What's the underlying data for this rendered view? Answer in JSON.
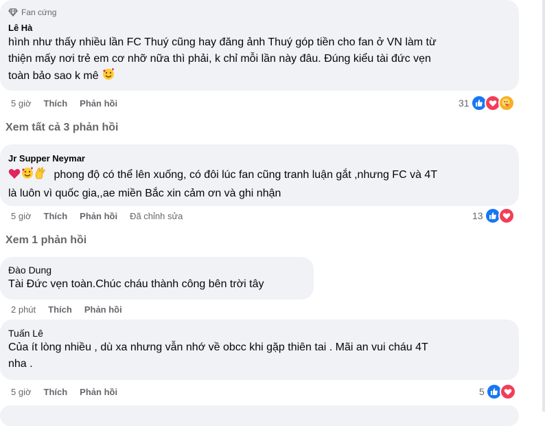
{
  "comments": [
    {
      "badge": "Fan cứng",
      "author": "Lê Hà",
      "lines": [
        "hình như thấy nhiều lần FC Thuý cũng hay đăng ảnh Thuý góp tiền cho fan ở VN làm từ",
        "thiện mấy nơi trẻ em cơ nhỡ nữa thì phải, k chỉ mỗi lần này đâu. Đúng kiểu tài đức vẹn",
        "toàn bảo sao k mê"
      ],
      "time": "5 giờ",
      "like": "Thích",
      "reply": "Phản hồi",
      "reactions": "31"
    },
    {
      "author": "Jr Supper Neymar",
      "lines": [
        "phong độ có thể lên xuống, có đôi lúc fan cũng tranh luận gắt ,nhưng FC và 4T",
        "là luôn vì quốc gia,,ae miền Bắc xin cảm ơn và ghi nhận"
      ],
      "time": "5 giờ",
      "like": "Thích",
      "reply": "Phản hồi",
      "edited": "Đã chỉnh sửa",
      "reactions": "13"
    },
    {
      "author": "Đào Dung",
      "lines": [
        "Tài Đức vẹn toàn.Chúc cháu thành công bên trời tây"
      ],
      "time": "2 phút",
      "like": "Thích",
      "reply": "Phản hồi"
    },
    {
      "author": "Tuấn Lê",
      "lines": [
        "Của ít lòng nhiều , dù xa nhưng vẫn nhớ về obcc khi gặp thiên tai . Mãi an vui cháu 4T",
        "nha ."
      ],
      "time": "5 giờ",
      "like": "Thích",
      "reply": "Phản hồi",
      "reactions": "5"
    }
  ],
  "view_replies": [
    "Xem tất cả 3 phản hồi",
    "Xem 1 phản hồi"
  ],
  "icons": {
    "badge": "diamond-icon",
    "like": "thumbs-up-icon",
    "love": "heart-icon",
    "care": "care-emoji-icon"
  },
  "colors": {
    "like": "#1877f2",
    "love": "#f33e58",
    "care": "#f7b125",
    "bubble": "#f0f2f5",
    "muted": "#65676b"
  }
}
